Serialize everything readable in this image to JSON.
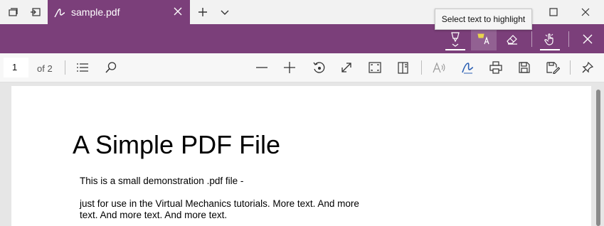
{
  "tab": {
    "title": "sample.pdf"
  },
  "tooltip": {
    "text": "Select text to highlight"
  },
  "toolbar": {
    "page_current": "1",
    "page_total": "of 2"
  },
  "document": {
    "title": "A Simple PDF File",
    "paragraph1": "This is a small demonstration .pdf file -",
    "paragraph2_line1": "just for use in the Virtual Mechanics tutorials. More text. And more",
    "paragraph2_line2": "text. And more text. And more text."
  },
  "colors": {
    "accent": "#7b3f7a",
    "highlight": "#e8d44d"
  }
}
